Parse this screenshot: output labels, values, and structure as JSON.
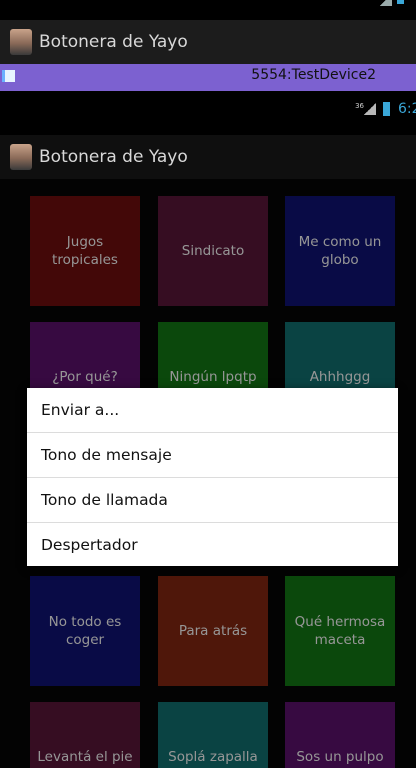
{
  "app": {
    "title": "Botonera de Yayo"
  },
  "emulator": {
    "title": "5554:TestDevice2"
  },
  "status": {
    "network_label": "36",
    "time": "6:2"
  },
  "colors": {
    "emulator_bar": "#7c61d0",
    "status_accent": "#3aa7d8"
  },
  "tiles": [
    {
      "label": "Jugos tropicales",
      "color": "#5a0b0b"
    },
    {
      "label": "Sindicato",
      "color": "#48122e"
    },
    {
      "label": "Me como un globo",
      "color": "#0d0f5e"
    },
    {
      "label": "¿Por qué?",
      "color": "#4a0e57"
    },
    {
      "label": "Ningún lpqtp",
      "color": "#0f6110"
    },
    {
      "label": "Ahhhggg",
      "color": "#0e5a5a"
    },
    {
      "label": "No todo es coger",
      "color": "#0d0f5e"
    },
    {
      "label": "Para atrás",
      "color": "#6a1f0e"
    },
    {
      "label": "Qué hermosa maceta",
      "color": "#0f6110"
    },
    {
      "label": "Levantá el pie",
      "color": "#48122e"
    },
    {
      "label": "Soplá zapalla",
      "color": "#0e5a5a"
    },
    {
      "label": "Sos un pulpo",
      "color": "#4a0e57"
    }
  ],
  "context_menu": {
    "items": [
      {
        "label": "Enviar a..."
      },
      {
        "label": "Tono de mensaje"
      },
      {
        "label": "Tono de llamada"
      },
      {
        "label": "Despertador"
      }
    ]
  }
}
